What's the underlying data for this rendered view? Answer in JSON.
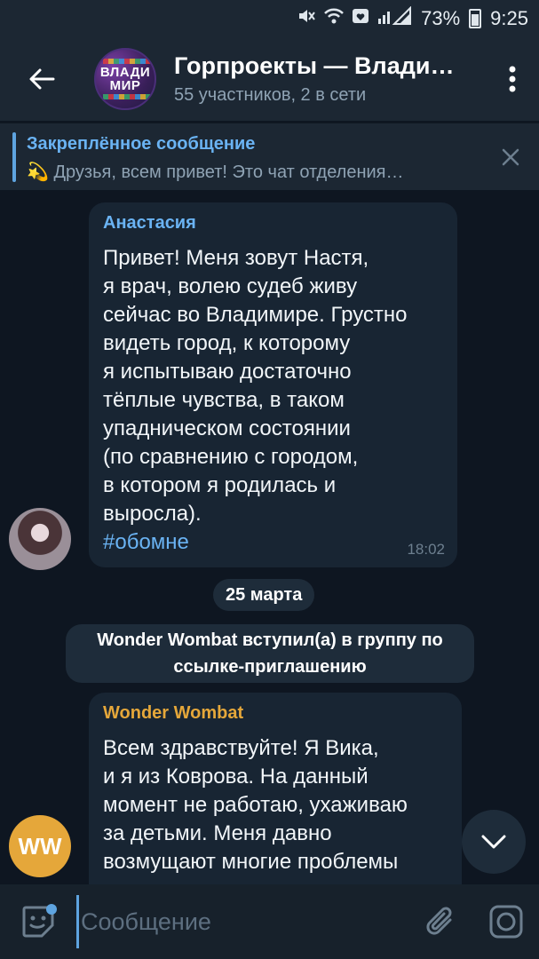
{
  "status_bar": {
    "battery": "73%",
    "time": "9:25"
  },
  "header": {
    "title": "Горпроекты — Влади…",
    "subtitle": "55 участников, 2 в сети",
    "avatar_text_line1": "ВЛАДИ",
    "avatar_text_line2": "МИР"
  },
  "pinned": {
    "title": "Закреплённое сообщение",
    "emoji": "💫",
    "text": "Друзья, всем привет!   Это чат отделения…"
  },
  "messages": [
    {
      "author": "Анастасия",
      "author_color": "#6ab3f3",
      "text": "Привет! Меня зовут Настя,\nя врач, волею судеб живу\nсейчас во Владимире. Грустно\nвидеть город, к которому\nя испытываю достаточно\nтёплые чувства, в таком\nупадническом состоянии\n(по сравнению с городом,\nв котором я родилась и\nвыросла).",
      "hashtag": "#обомне",
      "time": "18:02"
    },
    {
      "author": "Wonder Wombat",
      "author_color": "#e5a73a",
      "avatar_initials": "WW",
      "text": "Всем здравствуйте! Я Вика,\nи я из Коврова. На данный\nмомент не работаю, ухаживаю\nза детьми. Меня давно\nвозмущают многие проблемы"
    }
  ],
  "date_divider": "25 марта",
  "service_message": "Wonder Wombat вступил(а) в группу по\nссылке-приглашению",
  "input": {
    "placeholder": "Сообщение"
  }
}
